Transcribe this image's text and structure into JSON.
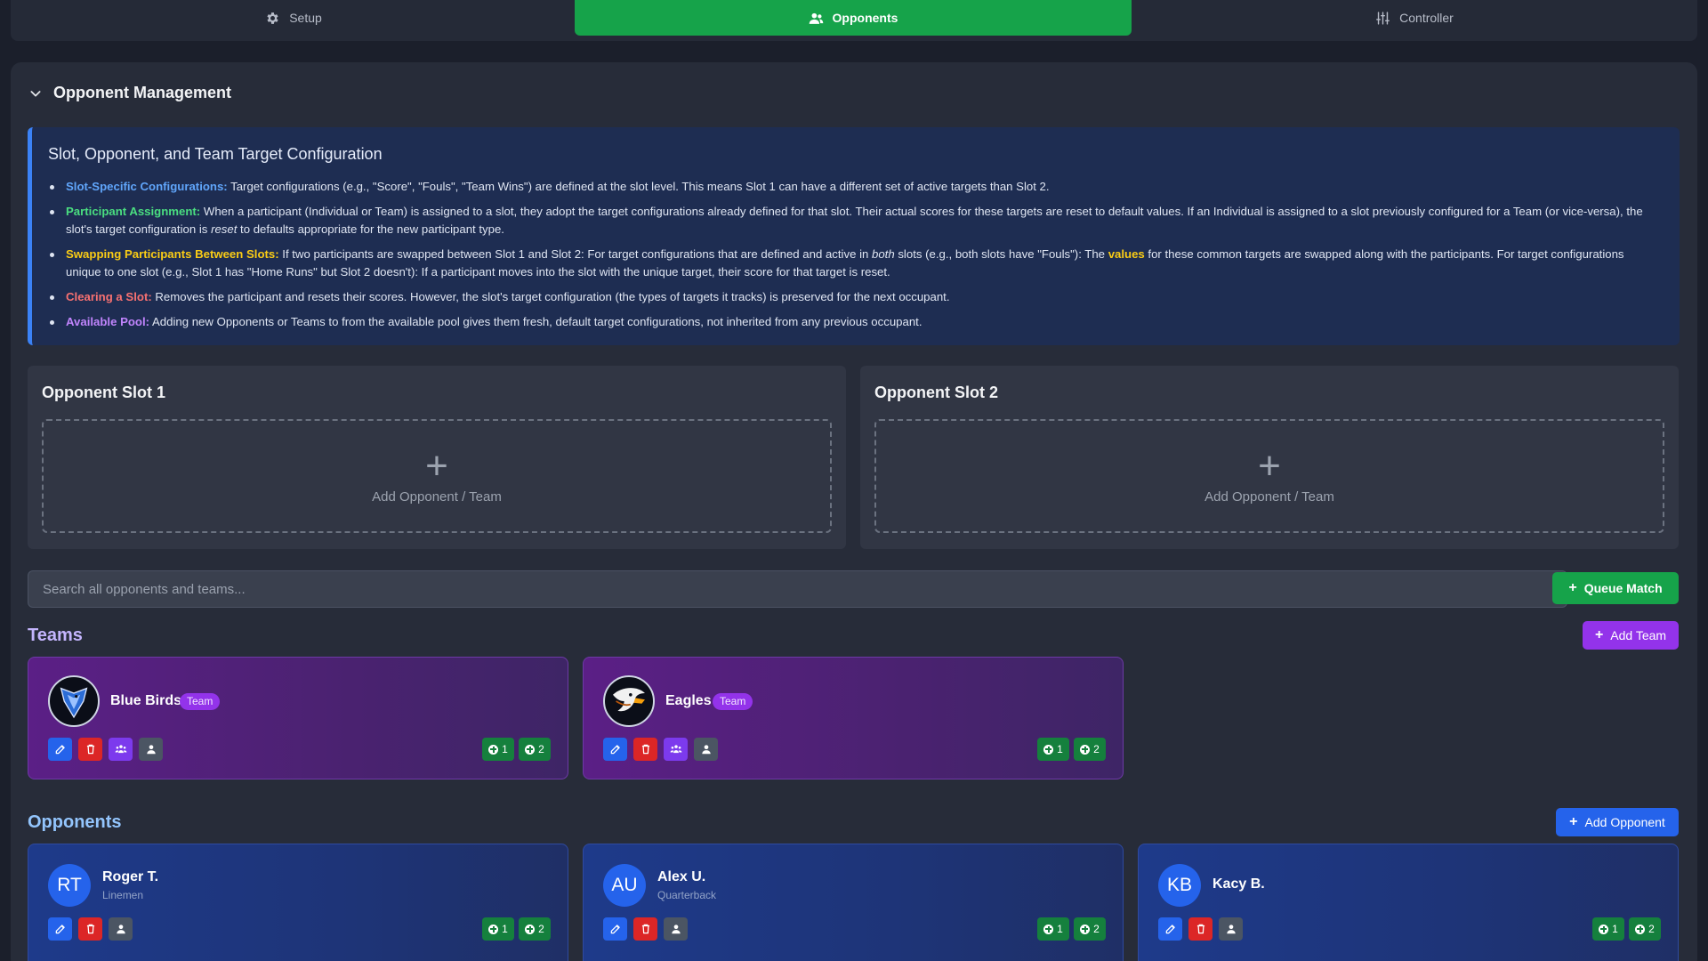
{
  "tabs": [
    {
      "label": "Setup",
      "icon": "gear-icon",
      "active": false
    },
    {
      "label": "Opponents",
      "icon": "users-icon",
      "active": true
    },
    {
      "label": "Controller",
      "icon": "sliders-icon",
      "active": false
    }
  ],
  "panel": {
    "title": "Opponent Management"
  },
  "info": {
    "title": "Slot, Opponent, and Team Target Configuration",
    "items": [
      {
        "key": "Slot-Specific Configurations:",
        "text": " Target configurations (e.g., \"Score\", \"Fouls\", \"Team Wins\") are defined at the slot level. This means Slot 1 can have a different set of active targets than Slot 2."
      },
      {
        "key": "Participant Assignment:",
        "text_a": " When a participant (Individual or Team) is assigned to a slot, they adopt the target configurations already defined for that slot. Their actual scores for these targets are reset to default values. If an Individual is assigned to a slot previously configured for a Team (or vice-versa), the slot's target configuration is ",
        "em": "reset",
        "text_b": " to defaults appropriate for the new participant type."
      },
      {
        "key": "Swapping Participants Between Slots:",
        "text_a": " If two participants are swapped between Slot 1 and Slot 2: For target configurations that are defined and active in ",
        "em": "both",
        "text_b": " slots (e.g., both slots have \"Fouls\"): The ",
        "strong": "values",
        "text_c": " for these common targets are swapped along with the participants. For target configurations unique to one slot (e.g., Slot 1 has \"Home Runs\" but Slot 2 doesn't): If a participant moves into the slot with the unique target, their score for that target is reset."
      },
      {
        "key": "Clearing a Slot:",
        "text": " Removes the participant and resets their scores. However, the slot's target configuration (the types of targets it tracks) is preserved for the next occupant."
      },
      {
        "key": "Available Pool:",
        "text": " Adding new Opponents or Teams to from the available pool gives them fresh, default target configurations, not inherited from any previous occupant."
      }
    ]
  },
  "slots": [
    {
      "title": "Opponent Slot 1",
      "plus": "+",
      "label": "Add Opponent / Team"
    },
    {
      "title": "Opponent Slot 2",
      "plus": "+",
      "label": "Add Opponent / Team"
    }
  ],
  "search": {
    "placeholder": "Search all opponents and teams...",
    "value": ""
  },
  "buttons": {
    "queue_match": "Queue Match",
    "add_team": "Add Team",
    "add_opponent": "Add Opponent",
    "plus": "+"
  },
  "teams_section": {
    "title": "Teams",
    "badge": "Team"
  },
  "teams": [
    {
      "name": "Blue Birds",
      "logo": "blue-bird-logo",
      "count_a": "1",
      "count_b": "2"
    },
    {
      "name": "Eagles",
      "logo": "eagle-logo",
      "count_a": "1",
      "count_b": "2"
    }
  ],
  "opponents_section": {
    "title": "Opponents"
  },
  "opponents": [
    {
      "initials": "RT",
      "name": "Roger T.",
      "role": "Linemen",
      "count_a": "1",
      "count_b": "2"
    },
    {
      "initials": "AU",
      "name": "Alex U.",
      "role": "Quarterback",
      "count_a": "1",
      "count_b": "2"
    },
    {
      "initials": "KB",
      "name": "Kacy B.",
      "role": "",
      "count_a": "1",
      "count_b": "2"
    }
  ],
  "colors": {
    "active_tab": "#16a34a",
    "team_card": "#5b1f86",
    "opponent_card": "#1e3a8a",
    "info_accent": "#3b82f6"
  }
}
